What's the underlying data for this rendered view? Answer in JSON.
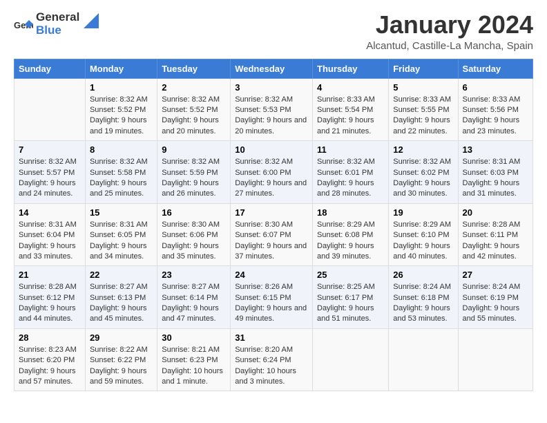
{
  "logo": {
    "general": "General",
    "blue": "Blue"
  },
  "title": "January 2024",
  "subtitle": "Alcantud, Castille-La Mancha, Spain",
  "days_of_week": [
    "Sunday",
    "Monday",
    "Tuesday",
    "Wednesday",
    "Thursday",
    "Friday",
    "Saturday"
  ],
  "weeks": [
    [
      {
        "day": "",
        "sunrise": "",
        "sunset": "",
        "daylight": ""
      },
      {
        "day": "1",
        "sunrise": "Sunrise: 8:32 AM",
        "sunset": "Sunset: 5:52 PM",
        "daylight": "Daylight: 9 hours and 19 minutes."
      },
      {
        "day": "2",
        "sunrise": "Sunrise: 8:32 AM",
        "sunset": "Sunset: 5:52 PM",
        "daylight": "Daylight: 9 hours and 20 minutes."
      },
      {
        "day": "3",
        "sunrise": "Sunrise: 8:32 AM",
        "sunset": "Sunset: 5:53 PM",
        "daylight": "Daylight: 9 hours and 20 minutes."
      },
      {
        "day": "4",
        "sunrise": "Sunrise: 8:33 AM",
        "sunset": "Sunset: 5:54 PM",
        "daylight": "Daylight: 9 hours and 21 minutes."
      },
      {
        "day": "5",
        "sunrise": "Sunrise: 8:33 AM",
        "sunset": "Sunset: 5:55 PM",
        "daylight": "Daylight: 9 hours and 22 minutes."
      },
      {
        "day": "6",
        "sunrise": "Sunrise: 8:33 AM",
        "sunset": "Sunset: 5:56 PM",
        "daylight": "Daylight: 9 hours and 23 minutes."
      }
    ],
    [
      {
        "day": "7",
        "sunrise": "Sunrise: 8:32 AM",
        "sunset": "Sunset: 5:57 PM",
        "daylight": "Daylight: 9 hours and 24 minutes."
      },
      {
        "day": "8",
        "sunrise": "Sunrise: 8:32 AM",
        "sunset": "Sunset: 5:58 PM",
        "daylight": "Daylight: 9 hours and 25 minutes."
      },
      {
        "day": "9",
        "sunrise": "Sunrise: 8:32 AM",
        "sunset": "Sunset: 5:59 PM",
        "daylight": "Daylight: 9 hours and 26 minutes."
      },
      {
        "day": "10",
        "sunrise": "Sunrise: 8:32 AM",
        "sunset": "Sunset: 6:00 PM",
        "daylight": "Daylight: 9 hours and 27 minutes."
      },
      {
        "day": "11",
        "sunrise": "Sunrise: 8:32 AM",
        "sunset": "Sunset: 6:01 PM",
        "daylight": "Daylight: 9 hours and 28 minutes."
      },
      {
        "day": "12",
        "sunrise": "Sunrise: 8:32 AM",
        "sunset": "Sunset: 6:02 PM",
        "daylight": "Daylight: 9 hours and 30 minutes."
      },
      {
        "day": "13",
        "sunrise": "Sunrise: 8:31 AM",
        "sunset": "Sunset: 6:03 PM",
        "daylight": "Daylight: 9 hours and 31 minutes."
      }
    ],
    [
      {
        "day": "14",
        "sunrise": "Sunrise: 8:31 AM",
        "sunset": "Sunset: 6:04 PM",
        "daylight": "Daylight: 9 hours and 33 minutes."
      },
      {
        "day": "15",
        "sunrise": "Sunrise: 8:31 AM",
        "sunset": "Sunset: 6:05 PM",
        "daylight": "Daylight: 9 hours and 34 minutes."
      },
      {
        "day": "16",
        "sunrise": "Sunrise: 8:30 AM",
        "sunset": "Sunset: 6:06 PM",
        "daylight": "Daylight: 9 hours and 35 minutes."
      },
      {
        "day": "17",
        "sunrise": "Sunrise: 8:30 AM",
        "sunset": "Sunset: 6:07 PM",
        "daylight": "Daylight: 9 hours and 37 minutes."
      },
      {
        "day": "18",
        "sunrise": "Sunrise: 8:29 AM",
        "sunset": "Sunset: 6:08 PM",
        "daylight": "Daylight: 9 hours and 39 minutes."
      },
      {
        "day": "19",
        "sunrise": "Sunrise: 8:29 AM",
        "sunset": "Sunset: 6:10 PM",
        "daylight": "Daylight: 9 hours and 40 minutes."
      },
      {
        "day": "20",
        "sunrise": "Sunrise: 8:28 AM",
        "sunset": "Sunset: 6:11 PM",
        "daylight": "Daylight: 9 hours and 42 minutes."
      }
    ],
    [
      {
        "day": "21",
        "sunrise": "Sunrise: 8:28 AM",
        "sunset": "Sunset: 6:12 PM",
        "daylight": "Daylight: 9 hours and 44 minutes."
      },
      {
        "day": "22",
        "sunrise": "Sunrise: 8:27 AM",
        "sunset": "Sunset: 6:13 PM",
        "daylight": "Daylight: 9 hours and 45 minutes."
      },
      {
        "day": "23",
        "sunrise": "Sunrise: 8:27 AM",
        "sunset": "Sunset: 6:14 PM",
        "daylight": "Daylight: 9 hours and 47 minutes."
      },
      {
        "day": "24",
        "sunrise": "Sunrise: 8:26 AM",
        "sunset": "Sunset: 6:15 PM",
        "daylight": "Daylight: 9 hours and 49 minutes."
      },
      {
        "day": "25",
        "sunrise": "Sunrise: 8:25 AM",
        "sunset": "Sunset: 6:17 PM",
        "daylight": "Daylight: 9 hours and 51 minutes."
      },
      {
        "day": "26",
        "sunrise": "Sunrise: 8:24 AM",
        "sunset": "Sunset: 6:18 PM",
        "daylight": "Daylight: 9 hours and 53 minutes."
      },
      {
        "day": "27",
        "sunrise": "Sunrise: 8:24 AM",
        "sunset": "Sunset: 6:19 PM",
        "daylight": "Daylight: 9 hours and 55 minutes."
      }
    ],
    [
      {
        "day": "28",
        "sunrise": "Sunrise: 8:23 AM",
        "sunset": "Sunset: 6:20 PM",
        "daylight": "Daylight: 9 hours and 57 minutes."
      },
      {
        "day": "29",
        "sunrise": "Sunrise: 8:22 AM",
        "sunset": "Sunset: 6:22 PM",
        "daylight": "Daylight: 9 hours and 59 minutes."
      },
      {
        "day": "30",
        "sunrise": "Sunrise: 8:21 AM",
        "sunset": "Sunset: 6:23 PM",
        "daylight": "Daylight: 10 hours and 1 minute."
      },
      {
        "day": "31",
        "sunrise": "Sunrise: 8:20 AM",
        "sunset": "Sunset: 6:24 PM",
        "daylight": "Daylight: 10 hours and 3 minutes."
      },
      {
        "day": "",
        "sunrise": "",
        "sunset": "",
        "daylight": ""
      },
      {
        "day": "",
        "sunrise": "",
        "sunset": "",
        "daylight": ""
      },
      {
        "day": "",
        "sunrise": "",
        "sunset": "",
        "daylight": ""
      }
    ]
  ],
  "accent_color": "#3a7bd5",
  "stripe_color": "#f0f4fa"
}
